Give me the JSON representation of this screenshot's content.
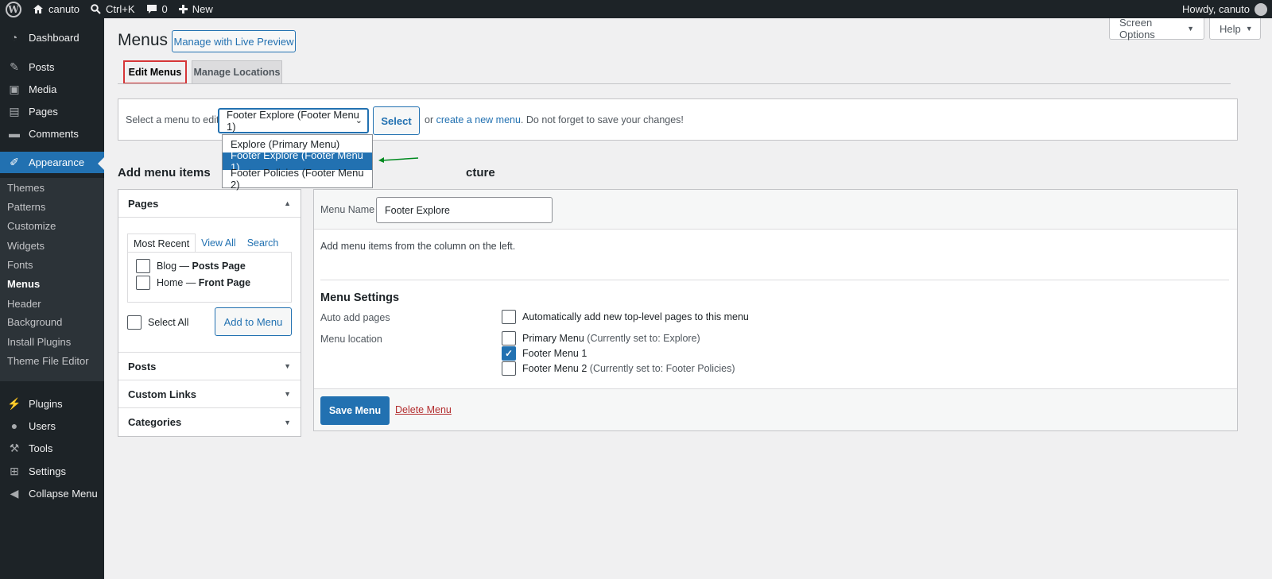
{
  "adminbar": {
    "site_name": "canuto",
    "search_shortcut": "Ctrl+K",
    "comments_count": "0",
    "new_label": "New",
    "howdy": "Howdy, canuto"
  },
  "sidebar": {
    "items": [
      {
        "label": "Dashboard",
        "icon": "dashboard-icon"
      },
      {
        "label": "Posts",
        "icon": "pin-icon"
      },
      {
        "label": "Media",
        "icon": "media-icon"
      },
      {
        "label": "Pages",
        "icon": "pages-icon"
      },
      {
        "label": "Comments",
        "icon": "comment-icon"
      },
      {
        "label": "Appearance",
        "icon": "brush-icon"
      },
      {
        "label": "Plugins",
        "icon": "plugin-icon"
      },
      {
        "label": "Users",
        "icon": "user-icon"
      },
      {
        "label": "Tools",
        "icon": "wrench-icon"
      },
      {
        "label": "Settings",
        "icon": "settings-icon"
      },
      {
        "label": "Collapse Menu",
        "icon": "collapse-icon"
      }
    ],
    "appearance_sub": [
      "Themes",
      "Patterns",
      "Customize",
      "Widgets",
      "Fonts",
      "Menus",
      "Header",
      "Background",
      "Install Plugins",
      "Theme File Editor"
    ]
  },
  "header": {
    "title": "Menus",
    "live_preview": "Manage with Live Preview",
    "screen_options": "Screen Options",
    "help": "Help"
  },
  "tabs": [
    "Edit Menus",
    "Manage Locations"
  ],
  "select_menu": {
    "label": "Select a menu to edit:",
    "current": "Footer Explore (Footer Menu 1)",
    "button": "Select",
    "or_text": "or",
    "create_link": "create a new menu",
    "suffix": ". Do not forget to save your changes!",
    "options": [
      "Explore (Primary Menu)",
      "Footer Explore (Footer Menu 1)",
      "Footer Policies (Footer Menu 2)"
    ]
  },
  "add_items": {
    "heading": "Add menu items",
    "pages_title": "Pages",
    "tabs": [
      "Most Recent",
      "View All",
      "Search"
    ],
    "pages": [
      {
        "title": "Blog",
        "suffix": "Posts Page"
      },
      {
        "title": "Home",
        "suffix": "Front Page"
      }
    ],
    "sep": " — ",
    "select_all": "Select All",
    "add_button": "Add to Menu",
    "sections": [
      "Posts",
      "Custom Links",
      "Categories"
    ]
  },
  "structure": {
    "heading": "Menu structure",
    "heading_visible": "cture",
    "name_label": "Menu Name",
    "name_value": "Footer Explore",
    "hint": "Add menu items from the column on the left.",
    "settings_title": "Menu Settings",
    "auto_add_label": "Auto add pages",
    "auto_add_text": "Automatically add new top-level pages to this menu",
    "location_label": "Menu location",
    "locations": [
      {
        "name": "Primary Menu",
        "note": "(Currently set to: Explore)",
        "checked": false
      },
      {
        "name": "Footer Menu 1",
        "note": "",
        "checked": true
      },
      {
        "name": "Footer Menu 2",
        "note": "(Currently set to: Footer Policies)",
        "checked": false
      }
    ],
    "save": "Save Menu",
    "delete": "Delete Menu"
  },
  "colors": {
    "accent": "#2271b1",
    "sidebar": "#1d2327",
    "highlight_border": "#d63638",
    "arrow": "#008a20"
  }
}
